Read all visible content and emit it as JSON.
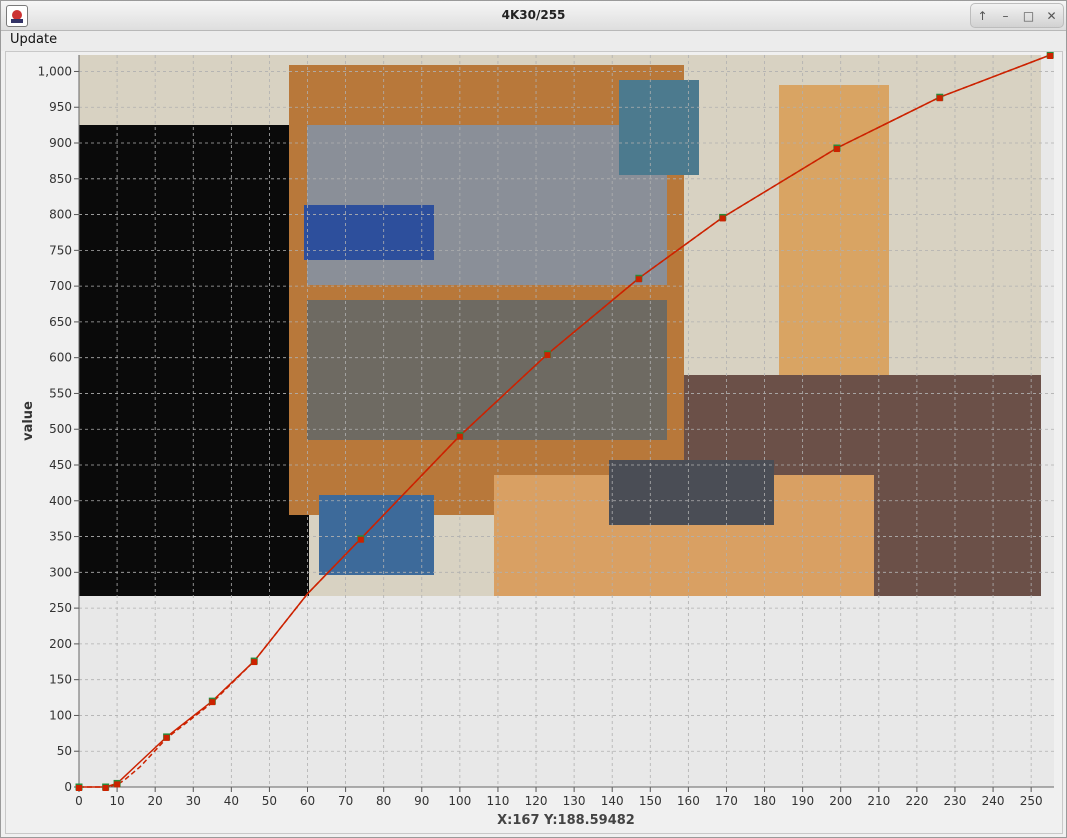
{
  "window": {
    "title": "4K30/255"
  },
  "menu": {
    "items": [
      "Update"
    ]
  },
  "icons": {
    "app": "app-icon",
    "controls": [
      "restore-icon",
      "minimize-icon",
      "maximize-icon",
      "close-icon"
    ]
  },
  "colors": {
    "curve": "#cc2200",
    "marker_fill": "#cc2200",
    "marker_alt": "#2a8a3a",
    "plot_bg": "#e8e8e8",
    "grid": "#b0b0b0"
  },
  "status": {
    "readout": "X:167 Y:188.59482"
  },
  "chart_data": {
    "type": "line",
    "title": "",
    "xlabel": "",
    "ylabel": "value",
    "xlim": [
      0,
      256
    ],
    "ylim": [
      0,
      1023
    ],
    "grid": true,
    "background_image": "room-photo",
    "x_ticks": [
      0,
      10,
      20,
      30,
      40,
      50,
      60,
      70,
      80,
      90,
      100,
      110,
      120,
      130,
      140,
      150,
      160,
      170,
      180,
      190,
      200,
      210,
      220,
      230,
      240,
      250
    ],
    "y_ticks": [
      0,
      50,
      100,
      150,
      200,
      250,
      300,
      350,
      400,
      450,
      500,
      550,
      600,
      650,
      700,
      750,
      800,
      850,
      900,
      950,
      1000
    ],
    "y_tick_labels": [
      "0",
      "50",
      "100",
      "150",
      "200",
      "250",
      "300",
      "350",
      "400",
      "450",
      "500",
      "550",
      "600",
      "650",
      "700",
      "750",
      "800",
      "850",
      "900",
      "950",
      "1,000"
    ],
    "series": [
      {
        "style": "solid",
        "x": [
          0,
          7,
          10,
          12,
          16,
          23,
          35,
          46,
          60,
          74,
          100,
          123,
          147,
          169,
          199,
          226,
          255
        ],
        "y": [
          0,
          0,
          5,
          15,
          35,
          70,
          120,
          176,
          270,
          347,
          491,
          605,
          711,
          796,
          893,
          964,
          1023
        ]
      },
      {
        "style": "dashed",
        "x": [
          0,
          7,
          10,
          12,
          16,
          23,
          35,
          46,
          60,
          74,
          100,
          123,
          147,
          169,
          199,
          226,
          255
        ],
        "y": [
          0,
          0,
          3,
          10,
          28,
          68,
          118,
          176,
          270,
          347,
          491,
          605,
          711,
          796,
          893,
          964,
          1023
        ]
      }
    ],
    "markers": {
      "x": [
        0,
        7,
        10,
        23,
        35,
        46,
        74,
        100,
        123,
        147,
        169,
        199,
        226,
        255
      ],
      "y": [
        0,
        0,
        5,
        70,
        120,
        176,
        347,
        491,
        605,
        711,
        796,
        893,
        964,
        1023
      ]
    }
  }
}
